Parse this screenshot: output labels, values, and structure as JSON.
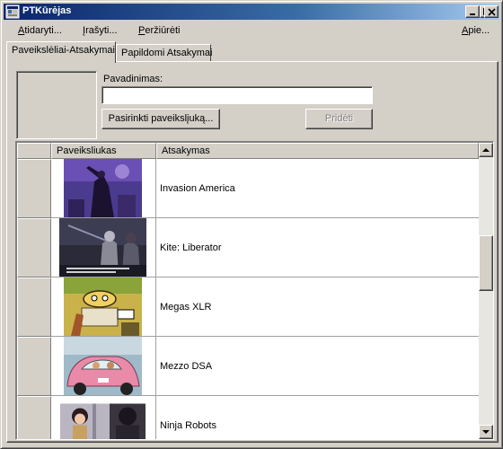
{
  "window": {
    "title": "PTKūrėjas"
  },
  "menu": {
    "open": {
      "accel": "A",
      "rest": "tidaryti..."
    },
    "save": {
      "accel": "Į",
      "rest": "rašyti..."
    },
    "view": {
      "accel": "P",
      "rest": "eržiūrėti"
    },
    "about": {
      "accel": "A",
      "rest": "pie..."
    }
  },
  "tabs": [
    {
      "label": "Paveikslėliai-Atsakymai",
      "active": true
    },
    {
      "label": "Papildomi Atsakymai",
      "active": false
    }
  ],
  "form": {
    "name_label": "Pavadinimas:",
    "name_value": "",
    "choose_image_button": "Pasirinkti paveikslįuką...",
    "add_button": "Pridėti",
    "add_enabled": false
  },
  "grid": {
    "columns": [
      "Paveiksliukas",
      "Atsakymas"
    ],
    "rows": [
      {
        "answer": "Invasion America",
        "thumb": "night-figures"
      },
      {
        "answer": "Kite: Liberator",
        "thumb": "dark-scene"
      },
      {
        "answer": "Megas XLR",
        "thumb": "cartoon-cockpit"
      },
      {
        "answer": "Mezzo DSA",
        "thumb": "pink-car"
      },
      {
        "answer": "Ninja Robots",
        "thumb": "anime-girl"
      }
    ]
  },
  "icons": {
    "app": "app-window-icon",
    "minimize": "minimize-icon",
    "maximize": "maximize-icon",
    "close": "close-icon",
    "scroll_up": "arrow-up-icon",
    "scroll_down": "arrow-down-icon"
  },
  "colors": {
    "title_start": "#0a246a",
    "title_end": "#a6caf0",
    "face": "#d4d0c8"
  }
}
